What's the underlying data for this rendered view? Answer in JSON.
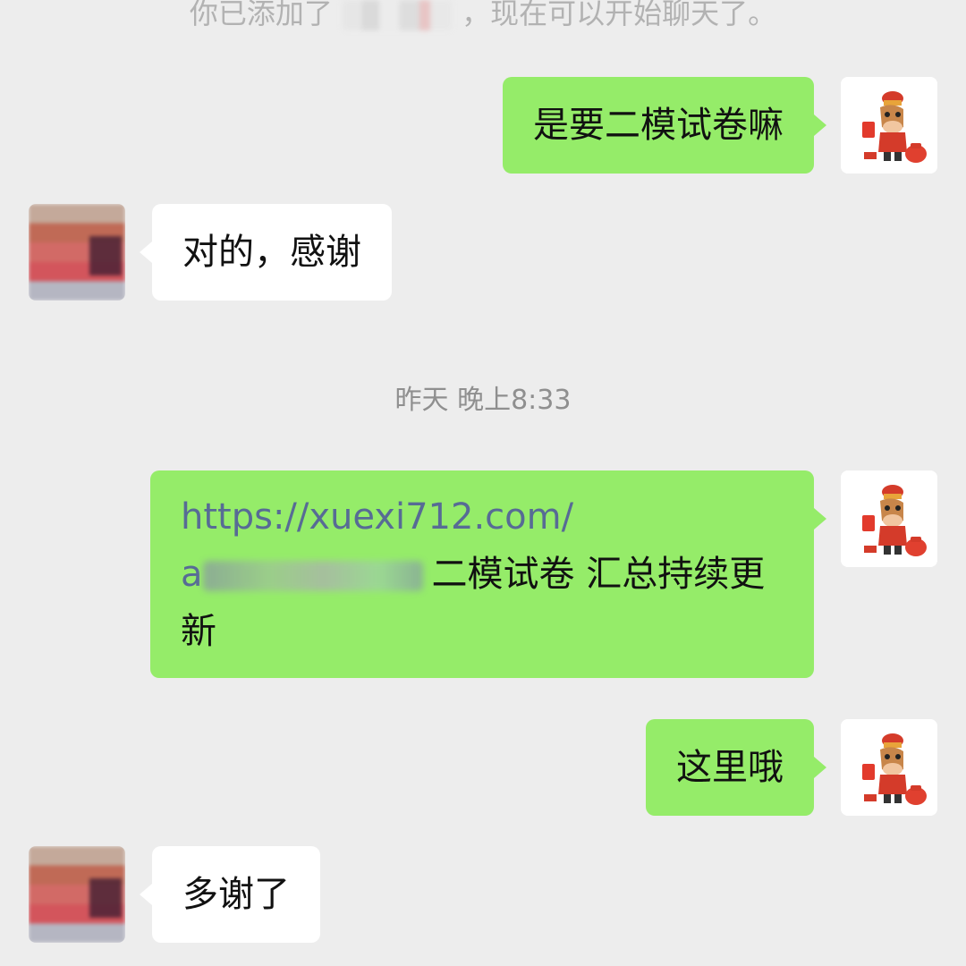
{
  "system_notice": {
    "prefix": "你已添加了",
    "suffix": "，现在可以开始聊天了。"
  },
  "messages": [
    {
      "sender": "self",
      "text": "是要二模试卷嘛"
    },
    {
      "sender": "other",
      "text": "对的，感谢"
    },
    {
      "sender": "self",
      "link_text": "https://xuexi712.com/",
      "link_tail": "a",
      "text_after": "二模试卷 汇总持续更新"
    },
    {
      "sender": "self",
      "text": "这里哦"
    },
    {
      "sender": "other",
      "text": "多谢了"
    }
  ],
  "timestamp": "昨天 晚上8:33",
  "colors": {
    "background": "#ededed",
    "self_bubble": "#95ec69",
    "other_bubble": "#ffffff",
    "link": "#576b95",
    "timestamp": "#8f8f8f"
  },
  "icons": {
    "self_avatar": "cartoon-horse-icon",
    "other_avatar": "blurred-profile-photo"
  }
}
